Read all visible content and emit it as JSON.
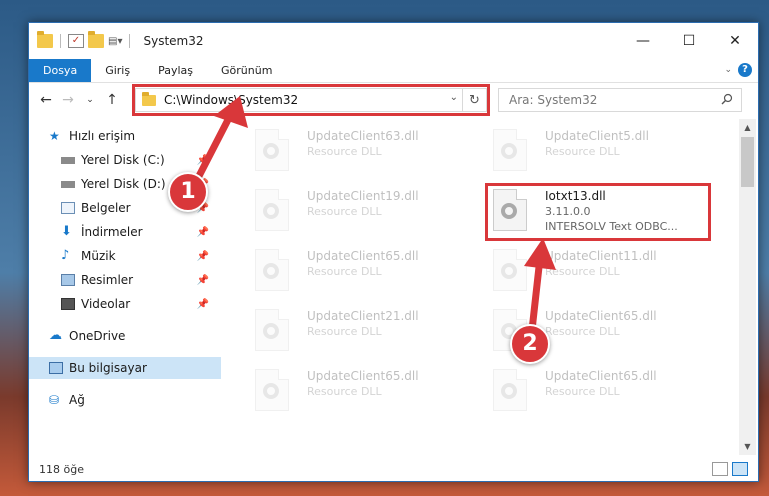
{
  "window": {
    "title": "System32",
    "controls": {
      "minimize": "—",
      "maximize": "☐",
      "close": "✕"
    }
  },
  "ribbon": {
    "tabs": [
      {
        "label": "Dosya",
        "active": true
      },
      {
        "label": "Giriş"
      },
      {
        "label": "Paylaş"
      },
      {
        "label": "Görünüm"
      }
    ]
  },
  "nav": {
    "address": "C:\\Windows\\System32",
    "search_placeholder": "Ara: System32"
  },
  "sidebar": {
    "items": [
      {
        "label": "Hızlı erişim",
        "icon": "star-icon"
      },
      {
        "label": "Yerel Disk (C:)",
        "icon": "drive-icon",
        "pinned": true
      },
      {
        "label": "Yerel Disk (D:)",
        "icon": "drive-icon",
        "pinned": true
      },
      {
        "label": "Belgeler",
        "icon": "documents-icon",
        "pinned": true
      },
      {
        "label": "İndirmeler",
        "icon": "download-icon",
        "pinned": true
      },
      {
        "label": "Müzik",
        "icon": "music-icon",
        "pinned": true
      },
      {
        "label": "Resimler",
        "icon": "pictures-icon",
        "pinned": true
      },
      {
        "label": "Videolar",
        "icon": "videos-icon",
        "pinned": true
      },
      {
        "label": "OneDrive",
        "icon": "cloud-icon"
      },
      {
        "label": "Bu bilgisayar",
        "icon": "computer-icon",
        "selected": true
      },
      {
        "label": "Ağ",
        "icon": "network-icon"
      }
    ]
  },
  "files": [
    {
      "name": "UpdateClient63.dll",
      "desc": "Resource DLL",
      "faded": true
    },
    {
      "name": "UpdateClient5.dll",
      "desc": "Resource DLL",
      "faded": true
    },
    {
      "name": "UpdateClient19.dll",
      "desc": "Resource DLL",
      "faded": true
    },
    {
      "name": "Iotxt13.dll",
      "desc": "3.11.0.0",
      "desc2": "INTERSOLV Text ODBC...",
      "faded": false
    },
    {
      "name": "UpdateClient65.dll",
      "desc": "Resource DLL",
      "faded": true
    },
    {
      "name": "UpdateClient11.dll",
      "desc": "Resource DLL",
      "faded": true
    },
    {
      "name": "UpdateClient21.dll",
      "desc": "Resource DLL",
      "faded": true
    },
    {
      "name": "UpdateClient65.dll",
      "desc": "Resource DLL",
      "faded": true
    },
    {
      "name": "UpdateClient65.dll",
      "desc": "Resource DLL",
      "faded": true
    },
    {
      "name": "UpdateClient65.dll",
      "desc": "Resource DLL",
      "faded": true
    }
  ],
  "status": {
    "count": "118 öğe"
  },
  "annotations": {
    "step1": "1",
    "step2": "2",
    "color": "#d9373a"
  }
}
